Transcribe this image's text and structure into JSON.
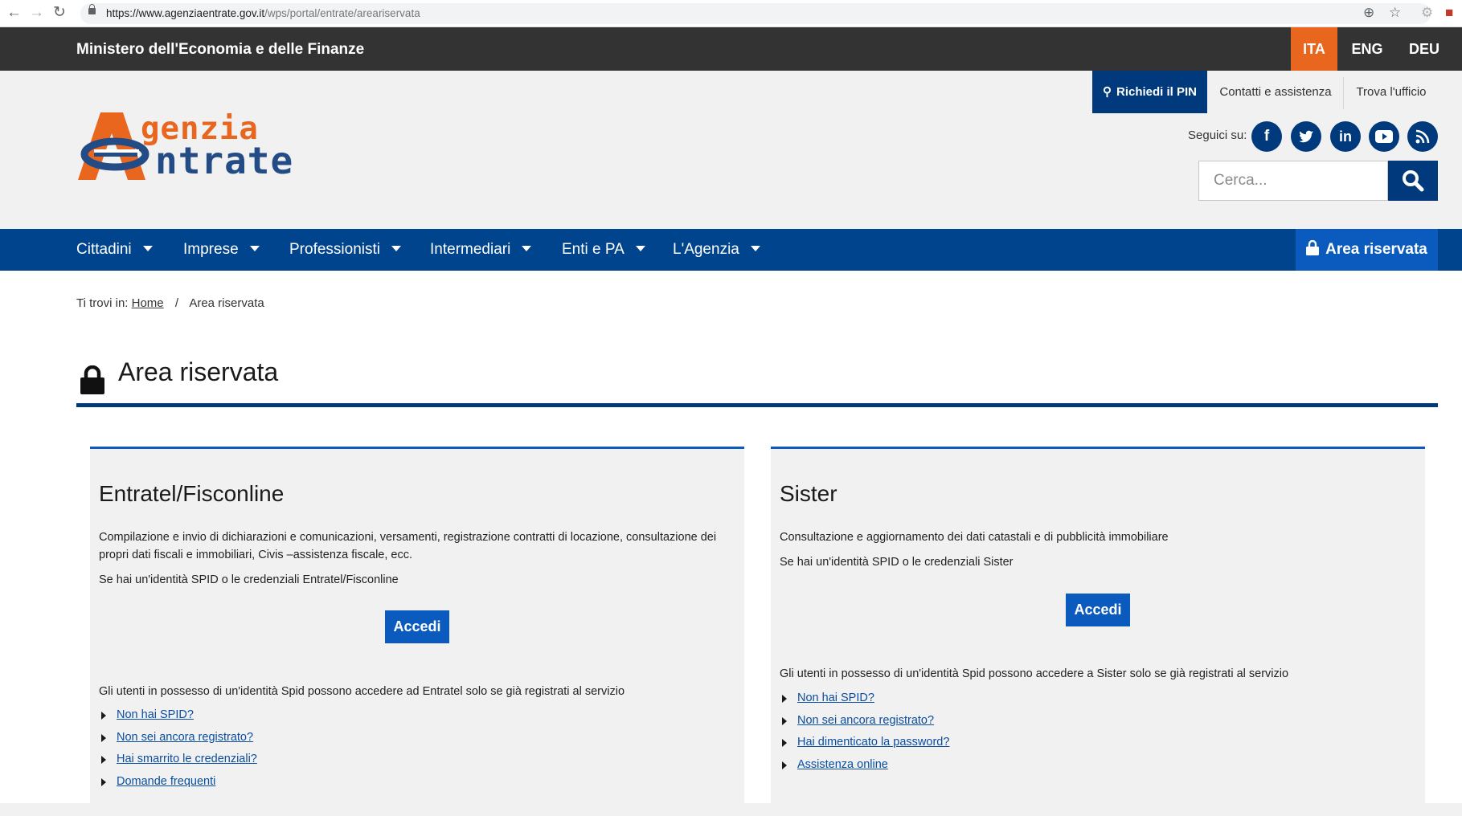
{
  "browser": {
    "url_host": "https://www.agenziaentrate.gov.it",
    "url_path": "/wps/portal/entrate/areariservata"
  },
  "top_bar": {
    "ministry": "Ministero dell'Economia e delle Finanze",
    "languages": [
      "ITA",
      "ENG",
      "DEU"
    ],
    "active_language": "ITA"
  },
  "header": {
    "logo_line1": "genzia",
    "logo_line2": "ntrate",
    "pin_button": "Richiedi il PIN",
    "contacts_link": "Contatti e assistenza",
    "office_link": "Trova l'ufficio",
    "follow_label": "Seguici su:",
    "social_icons": [
      "facebook-icon",
      "twitter-icon",
      "linkedin-icon",
      "youtube-icon",
      "rss-icon"
    ],
    "search_placeholder": "Cerca..."
  },
  "nav": {
    "items": [
      "Cittadini",
      "Imprese",
      "Professionisti",
      "Intermediari",
      "Enti e PA",
      "L'Agenzia"
    ],
    "area_button": "Area riservata"
  },
  "breadcrumb": {
    "prefix": "Ti trovi in:",
    "home": "Home",
    "separator": "/",
    "current": "Area riservata"
  },
  "page_title": "Area riservata",
  "cards": [
    {
      "title": "Entratel/Fisconline",
      "description": "Compilazione e invio di dichiarazioni e comunicazioni, versamenti, registrazione contratti di locazione, consultazione dei propri dati fiscali e immobiliari, Civis –assistenza fiscale, ecc.",
      "credentials_note": "Se hai un'identità SPID o le credenziali Entratel/Fisconline",
      "button": "Accedi",
      "spid_note": "Gli utenti in possesso di un'identità Spid possono accedere ad Entratel solo se già registrati al servizio",
      "links": [
        "Non hai SPID?",
        "Non sei ancora registrato?",
        "Hai smarrito le credenziali?",
        "Domande frequenti"
      ]
    },
    {
      "title": "Sister",
      "description": "Consultazione e aggiornamento dei dati catastali e di pubblicità immobiliare",
      "credentials_note": "Se hai un'identità SPID o le credenziali Sister",
      "button": "Accedi",
      "spid_note": "Gli utenti in possesso di un'identità Spid possono accedere a Sister solo se già registrati al servizio",
      "links": [
        "Non hai SPID?",
        "Non sei ancora registrato?",
        "Hai dimenticato la password?",
        "Assistenza online"
      ]
    }
  ],
  "colors": {
    "top_bar": "#333333",
    "active_language": "#e8661e",
    "dark_blue": "#003a7d",
    "nav_blue": "#00448d",
    "accent_blue": "#0a5bbd",
    "logo_orange": "#e8661e",
    "logo_blue": "#234b85"
  }
}
